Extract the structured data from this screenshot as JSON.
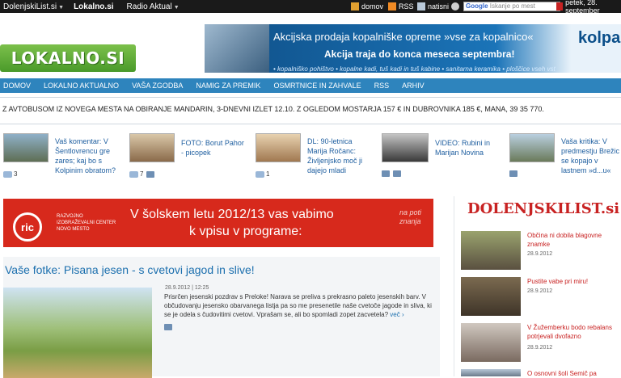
{
  "topbar": {
    "links": [
      "DolenjskiList.si",
      "Lokalno.si",
      "Radio Aktual"
    ],
    "right": {
      "home": "domov",
      "rss": "RSS",
      "print": "natisni",
      "search_brand": "Google",
      "search_placeholder": "Iskanje po mest",
      "date": "petek, 28. september"
    }
  },
  "logo": "LOKALNO.SI",
  "banner": {
    "line1": "Akcijska prodaja kopalniške opreme »vse za kopalnico«",
    "line2": "Akcija traja do konca meseca septembra!",
    "line3": "• kopalniško pohištvo • kopalne kadi, tuš kadi in tuš kabine • sanitarna keramika • ploščice vseh vst",
    "brand": "kolpa"
  },
  "nav": [
    "DOMOV",
    "LOKALNO AKTUALNO",
    "VAŠA ZGODBA",
    "NAMIG ZA PREMIK",
    "OSMRTNICE IN ZAHVALE",
    "RSS",
    "ARHIV"
  ],
  "ticker": "Z AVTOBUSOM IZ NOVEGA MESTA NA OBIRANJE MANDARIN,  3-DNEVNI IZLET 12.10. Z OGLEDOM MOSTARJA 157 € IN DUBROVNIKA  185 €, MANA, 39 35 770.",
  "teasers": [
    {
      "text": "Vaš komentar: V Šentlovrencu gre zares; kaj bo s Kolpinim obratom?",
      "comments": "3",
      "photo": false
    },
    {
      "text": "FOTO: Borut Pahor - picopek",
      "comments": "7",
      "photo": true
    },
    {
      "text": "DL: 90-letnica Marija Ročanc: Življenjsko moč ji dajejo mladi",
      "comments": "1",
      "photo": false
    },
    {
      "text": "VIDEO: Rubini in Marijan Novina",
      "comments": "",
      "photo": true
    },
    {
      "text": "Vaša kritika: V predmestju Brežic se kopajo v lastnem »d...u«",
      "comments": "",
      "photo": true
    }
  ],
  "ad": {
    "logo": "ric",
    "org": "RAZVOJNO IZOBRAŽEVALNI CENTER NOVO MESTO",
    "line1": "V šolskem letu 2012/13 vas vabimo",
    "line2": "k vpisu v programe:",
    "slogan": "na poti znanja"
  },
  "article": {
    "title": "Vaše fotke: Pisana jesen  - s cvetovi jagod in slive!",
    "date": "28.9.2012 | 12:25",
    "body": "Prisrčen jesenski pozdrav s Preloke! Narava se preliva s prekrasno paleto jesenskih barv. V občudovanju jesensko obarvanega listja pa so me presenetile naše cvetoče jagode in sliva, ki se je odela s čudovitimi cvetovi. Vprašam se, ali bo spomladi zopet zacvetela?",
    "more": "več ›"
  },
  "sidebar": {
    "brand": "DOLENJSKILIST.si",
    "items": [
      {
        "title": "Občina ni dobila blagovne znamke",
        "date": "28.9.2012"
      },
      {
        "title": "Pustite vabe pri miru!",
        "date": "28.9.2012"
      },
      {
        "title": "V Žužemberku bodo rebalans potrjevali dvofazno",
        "date": "28.9.2012"
      },
      {
        "title": "O osnovni šoli Semič pa",
        "date": ""
      }
    ]
  }
}
